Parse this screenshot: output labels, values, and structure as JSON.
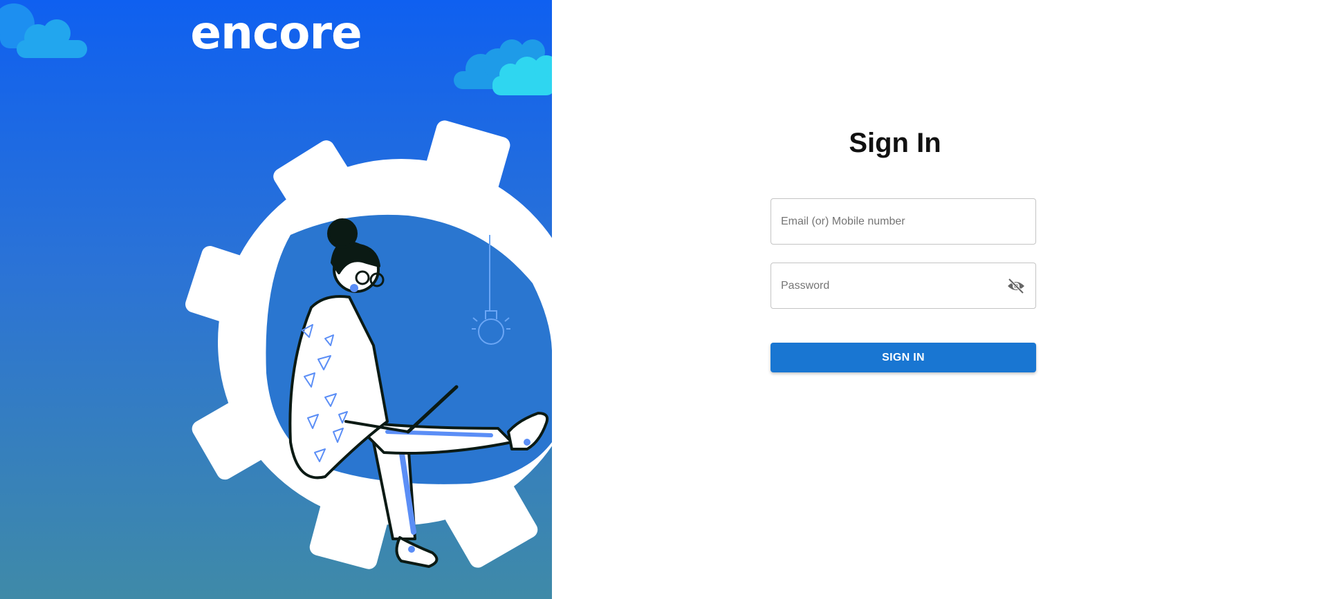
{
  "hero": {
    "brand": "encore",
    "illustration": "person-sitting-on-gear-with-laptop",
    "colors": {
      "gradient_top": "#0f60f0",
      "gradient_bottom": "#3f8aa8",
      "cloud": "#1e9be8",
      "cloud_light": "#2fd6f0"
    }
  },
  "signin": {
    "title": "Sign In",
    "email_placeholder": "Email (or) Mobile number",
    "password_placeholder": "Password",
    "password_toggle_icon": "eye-off-icon",
    "button_label": "SIGN IN",
    "accent": "#1976d2"
  }
}
